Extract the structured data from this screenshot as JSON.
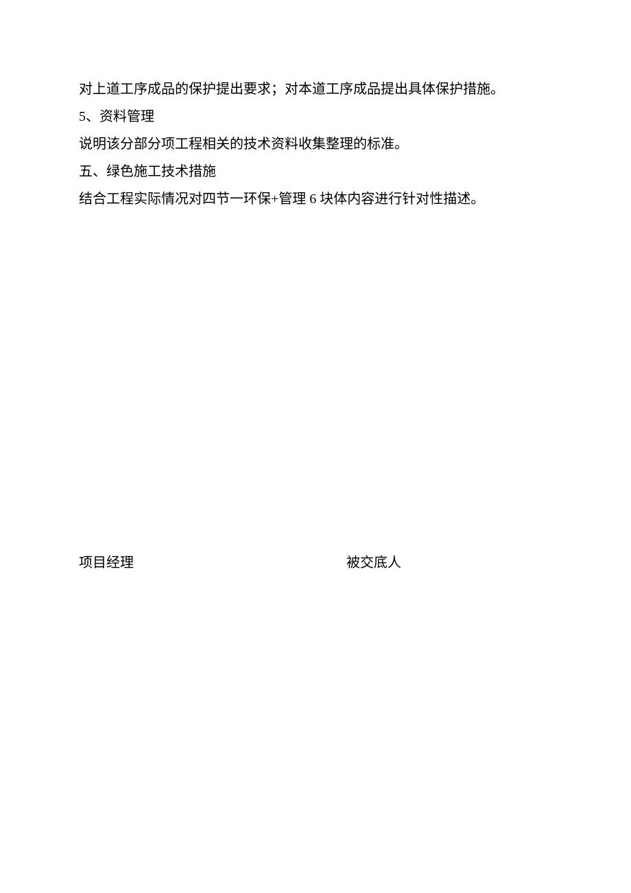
{
  "body": {
    "lines": [
      "对上道工序成品的保护提出要求；对本道工序成品提出具体保护措施。",
      "5、资料管理",
      "说明该分部分项工程相关的技术资料收集整理的标准。",
      "五、绿色施工技术措施",
      "结合工程实际情况对四节一环保+管理 6 块体内容进行针对性描述。"
    ]
  },
  "signatures": {
    "left": "项目经理",
    "right": "被交底人"
  }
}
